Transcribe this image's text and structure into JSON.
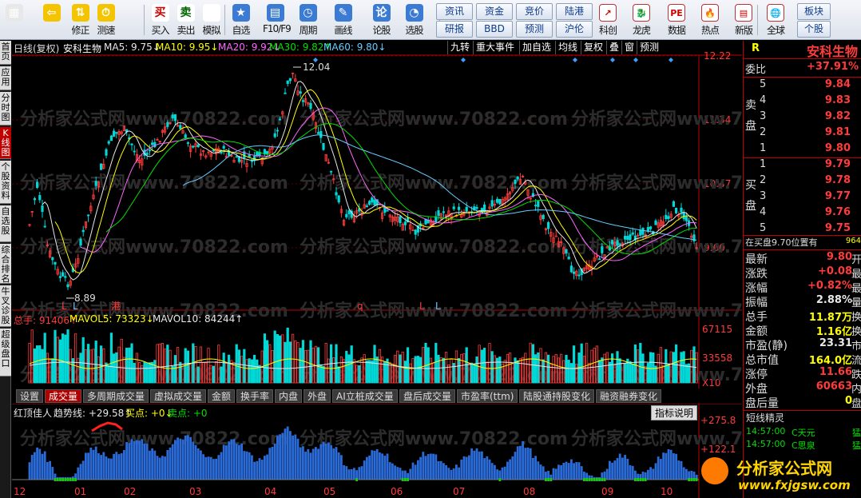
{
  "toolbar": {
    "buttons": [
      {
        "label": "",
        "icon": "windows-icon"
      },
      {
        "label": "",
        "icon": "back-arrow-icon"
      },
      {
        "label": "修正",
        "icon": "up-down-icon"
      },
      {
        "label": "测速",
        "icon": "speed-icon"
      },
      {
        "label": "买入",
        "icon": "buy-icon"
      },
      {
        "label": "卖出",
        "icon": "sell-icon"
      },
      {
        "label": "模拟",
        "icon": "hammer-icon"
      },
      {
        "label": "自选",
        "icon": "star-icon"
      },
      {
        "label": "F10/F9",
        "icon": "f10-icon"
      },
      {
        "label": "周期",
        "icon": "cycle-icon"
      },
      {
        "label": "画线",
        "icon": "pencil-icon"
      },
      {
        "label": "论股",
        "icon": "discuss-icon"
      },
      {
        "label": "选股",
        "icon": "select-stock-icon"
      }
    ],
    "grid_buttons": [
      "资讯",
      "资金",
      "竞价",
      "陆港",
      "研报",
      "BBD",
      "预测",
      "沪伦"
    ],
    "right_buttons": [
      {
        "label": "科创",
        "icon": "chart-icon"
      },
      {
        "label": "龙虎",
        "icon": "dragon-icon"
      },
      {
        "label": "数据",
        "icon": "pe-icon"
      },
      {
        "label": "热点",
        "icon": "hot-icon"
      },
      {
        "label": "新版",
        "icon": "new-icon"
      },
      {
        "label": "全球",
        "icon": "globe-icon"
      }
    ],
    "side_buttons": [
      "板块",
      "个股"
    ]
  },
  "left_tabs": [
    "首页",
    "应用",
    "分时图",
    "K线图",
    "个股资料",
    "自选股",
    "综合排名",
    "牛叉诊股",
    "超级盘口"
  ],
  "chart_header": {
    "period": "日线(复权)",
    "stock": "安科生物",
    "ma5": "MA5: 9.75↓",
    "ma10": "MA10: 9.95↓",
    "ma20": "MA20: 9.92↓",
    "ma30": "MA30: 9.82↑",
    "ma60": "MA60: 9.80↓",
    "menu": [
      "九转",
      "重大事件",
      "加自选",
      "均线",
      "复权",
      "叠",
      "窗",
      "预测"
    ]
  },
  "price_axis": [
    "12.22",
    "11.34",
    "10.47",
    "9.60"
  ],
  "volume_axis": [
    "67115",
    "33558",
    "X10"
  ],
  "indicator_axis": [
    "+275.8",
    "+122.1"
  ],
  "annotations": {
    "high": "12.04",
    "low": "8.89",
    "markers": [
      "L",
      "L",
      "港",
      "q",
      "L",
      "L"
    ]
  },
  "volume_header": {
    "total": "总手: 91406↑",
    "mavol5": "MAVOL5: 73323↓",
    "mavol10": "MAVOL10: 84244↑"
  },
  "volume_tabs": [
    "设置",
    "成交量",
    "多周期成交量",
    "虚拟成交量",
    "金额",
    "换手率",
    "内盘",
    "外盘",
    "AI立桩成交量",
    "盘后成交量",
    "市盈率(ttm)",
    "陆股通持股变化",
    "融资融券变化"
  ],
  "indicator_header": {
    "name": "红顶佳人",
    "trend": "趋势线: +29.58↑",
    "buy": "买点: +0↓",
    "sell": "卖点: +0",
    "help": "指标说明"
  },
  "months": [
    "12",
    "01",
    "02",
    "03",
    "04",
    "05",
    "06",
    "07",
    "08",
    "09",
    "10"
  ],
  "watermark": "分析家公式网www.70822.com",
  "right_panel": {
    "code_tag": "R",
    "name": "安科生物",
    "weibi_label": "委比",
    "weibi_value": "+37.91%",
    "sell_label": "卖盘",
    "buy_label": "买盘",
    "sell_levels": [
      {
        "n": "5",
        "p": "9.84"
      },
      {
        "n": "4",
        "p": "9.83"
      },
      {
        "n": "3",
        "p": "9.82"
      },
      {
        "n": "2",
        "p": "9.81"
      },
      {
        "n": "1",
        "p": "9.80"
      }
    ],
    "buy_levels": [
      {
        "n": "1",
        "p": "9.79"
      },
      {
        "n": "2",
        "p": "9.78"
      },
      {
        "n": "3",
        "p": "9.77"
      },
      {
        "n": "4",
        "p": "9.76"
      },
      {
        "n": "5",
        "p": "9.75"
      }
    ],
    "order_note": "在买盘9.70位置有",
    "order_value": "964",
    "stats": [
      {
        "k": "最新",
        "v": "9.80",
        "c": "red",
        "s": "开"
      },
      {
        "k": "涨跌",
        "v": "+0.08",
        "c": "red",
        "s": "最"
      },
      {
        "k": "涨幅",
        "v": "+0.82%",
        "c": "red",
        "s": "最"
      },
      {
        "k": "振幅",
        "v": "2.88%",
        "c": "wht",
        "s": "量"
      },
      {
        "k": "总手",
        "v": "11.87万",
        "c": "yel",
        "s": "换"
      },
      {
        "k": "金额",
        "v": "1.16亿",
        "c": "yel",
        "s": "换"
      },
      {
        "k": "市盈(静)",
        "v": "23.31",
        "c": "wht",
        "s": "市"
      },
      {
        "k": "总市值",
        "v": "164.0亿",
        "c": "yel",
        "s": "流"
      },
      {
        "k": "涨停",
        "v": "11.66",
        "c": "red",
        "s": "跌"
      },
      {
        "k": "外盘",
        "v": "60663",
        "c": "red",
        "s": "内"
      },
      {
        "k": "盘后量",
        "v": "0",
        "c": "yel",
        "s": "盘"
      }
    ],
    "short_title": "短线精灵",
    "short_items": [
      {
        "t": "14:57:00",
        "n": "C天元",
        "a": "猛"
      },
      {
        "t": "14:57:00",
        "n": "C思泉",
        "a": "猛"
      }
    ]
  },
  "logo": {
    "text": "分析家公式网",
    "url": "www.fxjgsw.com"
  }
}
